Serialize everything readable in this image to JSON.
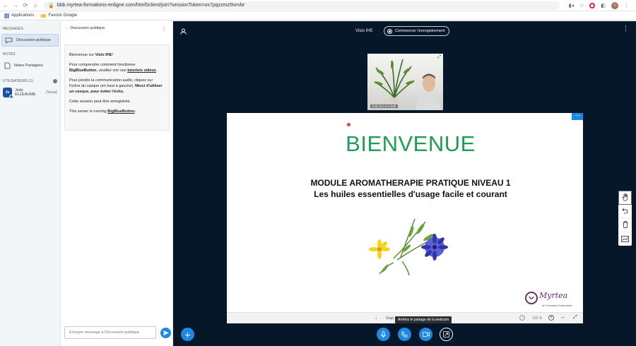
{
  "browser": {
    "url": "bbb.myrtea-formations-enligne.com/html5client/join?sessionToken=os7pqzzmz5tvrvbr",
    "bookmarks": [
      "Applications",
      "Favoris Google"
    ]
  },
  "left_nav": {
    "messages_title": "MESSAGES",
    "public_chat": "Discussion publique",
    "notes_title": "NOTES",
    "shared_notes": "Notes Partagées",
    "users_title": "UTILISATEURS (1)",
    "user": {
      "initials": "Jo",
      "name": "Jody ELLEAUME",
      "you_label": "(Vous)"
    }
  },
  "chat": {
    "header": "Discussion publique",
    "welcome": {
      "line1_pre": "Bienvenue sur ",
      "line1_bold": "Visio IHE",
      "line1_post": "!",
      "p2_pre": "Pour comprendre comment fonctionne ",
      "p2_bold": "BigBlueButton",
      "p2_mid": ", veuillez voir nos ",
      "p2_link": "tutoriels vidéos",
      "p2_post": ".",
      "p3_pre": "Pour joindre la communication audio, cliquez sur l'icône du casque (en haut à gauche). ",
      "p3_bold": "Merci d'utiliser un casque, pour éviter l'écho.",
      "p4": "Cette session peut être enregistrée.",
      "p5_pre": "This server is running ",
      "p5_link": "BigBlueButton",
      "p5_post": "."
    },
    "input_placeholder": "Envoyer message à Discussion publique"
  },
  "main": {
    "room_title": "Visio IHE",
    "record_label": "Commencer l'enregistrement",
    "webcam_name": "Jody ELLEAUME"
  },
  "slide": {
    "title": "BIENVENUE",
    "subtitle1": "MODULE AROMATHERAPIE PRATIQUE NIVEAU 1",
    "subtitle2": "Les huiles essentielles d'usage facile et courant",
    "logo_text": "Myrtea",
    "logo_sub": "la Formation Essentielle"
  },
  "slide_bar": {
    "label": "Diap",
    "zoom": "100 %"
  },
  "tooltip": "Arrêtez le partage de la webcam",
  "colors": {
    "accent": "#1e88e5",
    "main_bg": "#06172a",
    "slide_title": "#1e9d58"
  }
}
